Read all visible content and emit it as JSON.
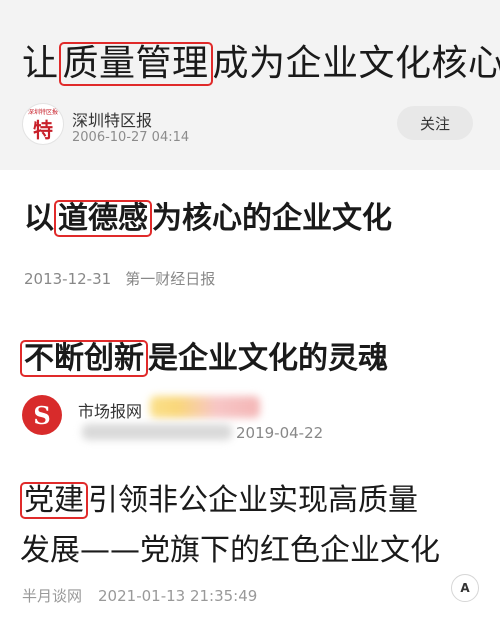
{
  "article1": {
    "title_highlight": "质量管理",
    "title_prefix": "让",
    "title_suffix": "成为企业文化核心",
    "avatar_char": "特",
    "avatar_top": "深圳特区报",
    "source": "深圳特区报",
    "time": "2006-10-27 04:14",
    "follow_label": "关注"
  },
  "article2": {
    "title_prefix": "以",
    "title_highlight": "道德感",
    "title_suffix": "为核心的企业文化",
    "date": "2013-12-31",
    "source": "第一财经日报"
  },
  "article3": {
    "title_highlight": "不断创新",
    "title_suffix": "是企业文化的灵魂",
    "logo_char": "S",
    "source": "市场报网",
    "date": "2019-04-22"
  },
  "article4": {
    "title_highlight": "党建",
    "title_line1_suffix": "引领非公企业实现高质量",
    "title_line2": "发展——党旗下的红色企业文化",
    "source": "半月谈网",
    "time": "2021-01-13 21:35:49",
    "font_button_label": "A"
  },
  "colors": {
    "highlight_border": "#e02a2a",
    "card_bg": "#f3f3f3"
  }
}
